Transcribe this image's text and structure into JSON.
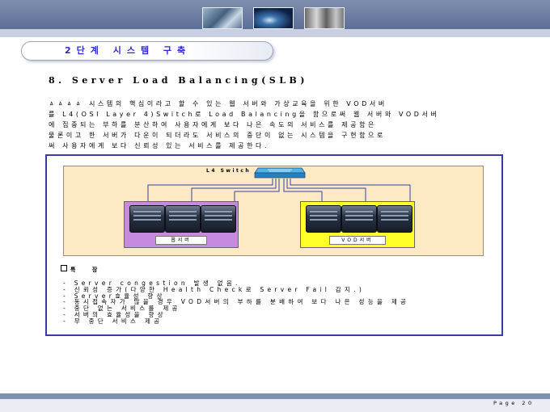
{
  "header": {
    "section_title": "2단계 시스템 구축"
  },
  "heading": "8. Server Load Balancing(SLB)",
  "paragraph": [
    "ㅿㅿㅿㅿ 시스템의 핵심이라고 할 수 있는 웹 서버와 가상교육을 위한 VOD서버",
    "를 L4(OSI Layer 4)Switch로 Load Balancing을 함으로써 웹 서버와 VOD서버",
    "에 집중되는 부하를 분산하여 사용자에게 보다 나은 속도의 서비스를 제공함은",
    "물론이고 한 서버가 다운이 되더라도 서비스의 중단이 없는 시스템을 구현함으로",
    "써 사용자에게 보다 신뢰성 있는 서비스를 제공한다."
  ],
  "diagram": {
    "switch_label": "L4 Switch",
    "web_group_label": "웹서버",
    "vod_group_label": "VOD서버",
    "colors": {
      "web_group": "#c88ae0",
      "vod_group": "#ffff2a",
      "background": "#fde9c4"
    }
  },
  "features": {
    "title": "특 장",
    "items": [
      "- Server congestion 발생 없음.",
      "- 신뢰성 증가(다양한 Health Check로 Server Fail 감지.)",
      "- Server효율성 향상",
      "- 동시접속자가 많을 경우 VOD서버의 부하를 분배하여 보다 나은 성능을 제공",
      "- 중단 없는 서비스를 제공",
      "- 서버의 효율성을 향상",
      "- 무 중단 서비스 제공"
    ]
  },
  "footer": {
    "page_label": "Page 20"
  }
}
